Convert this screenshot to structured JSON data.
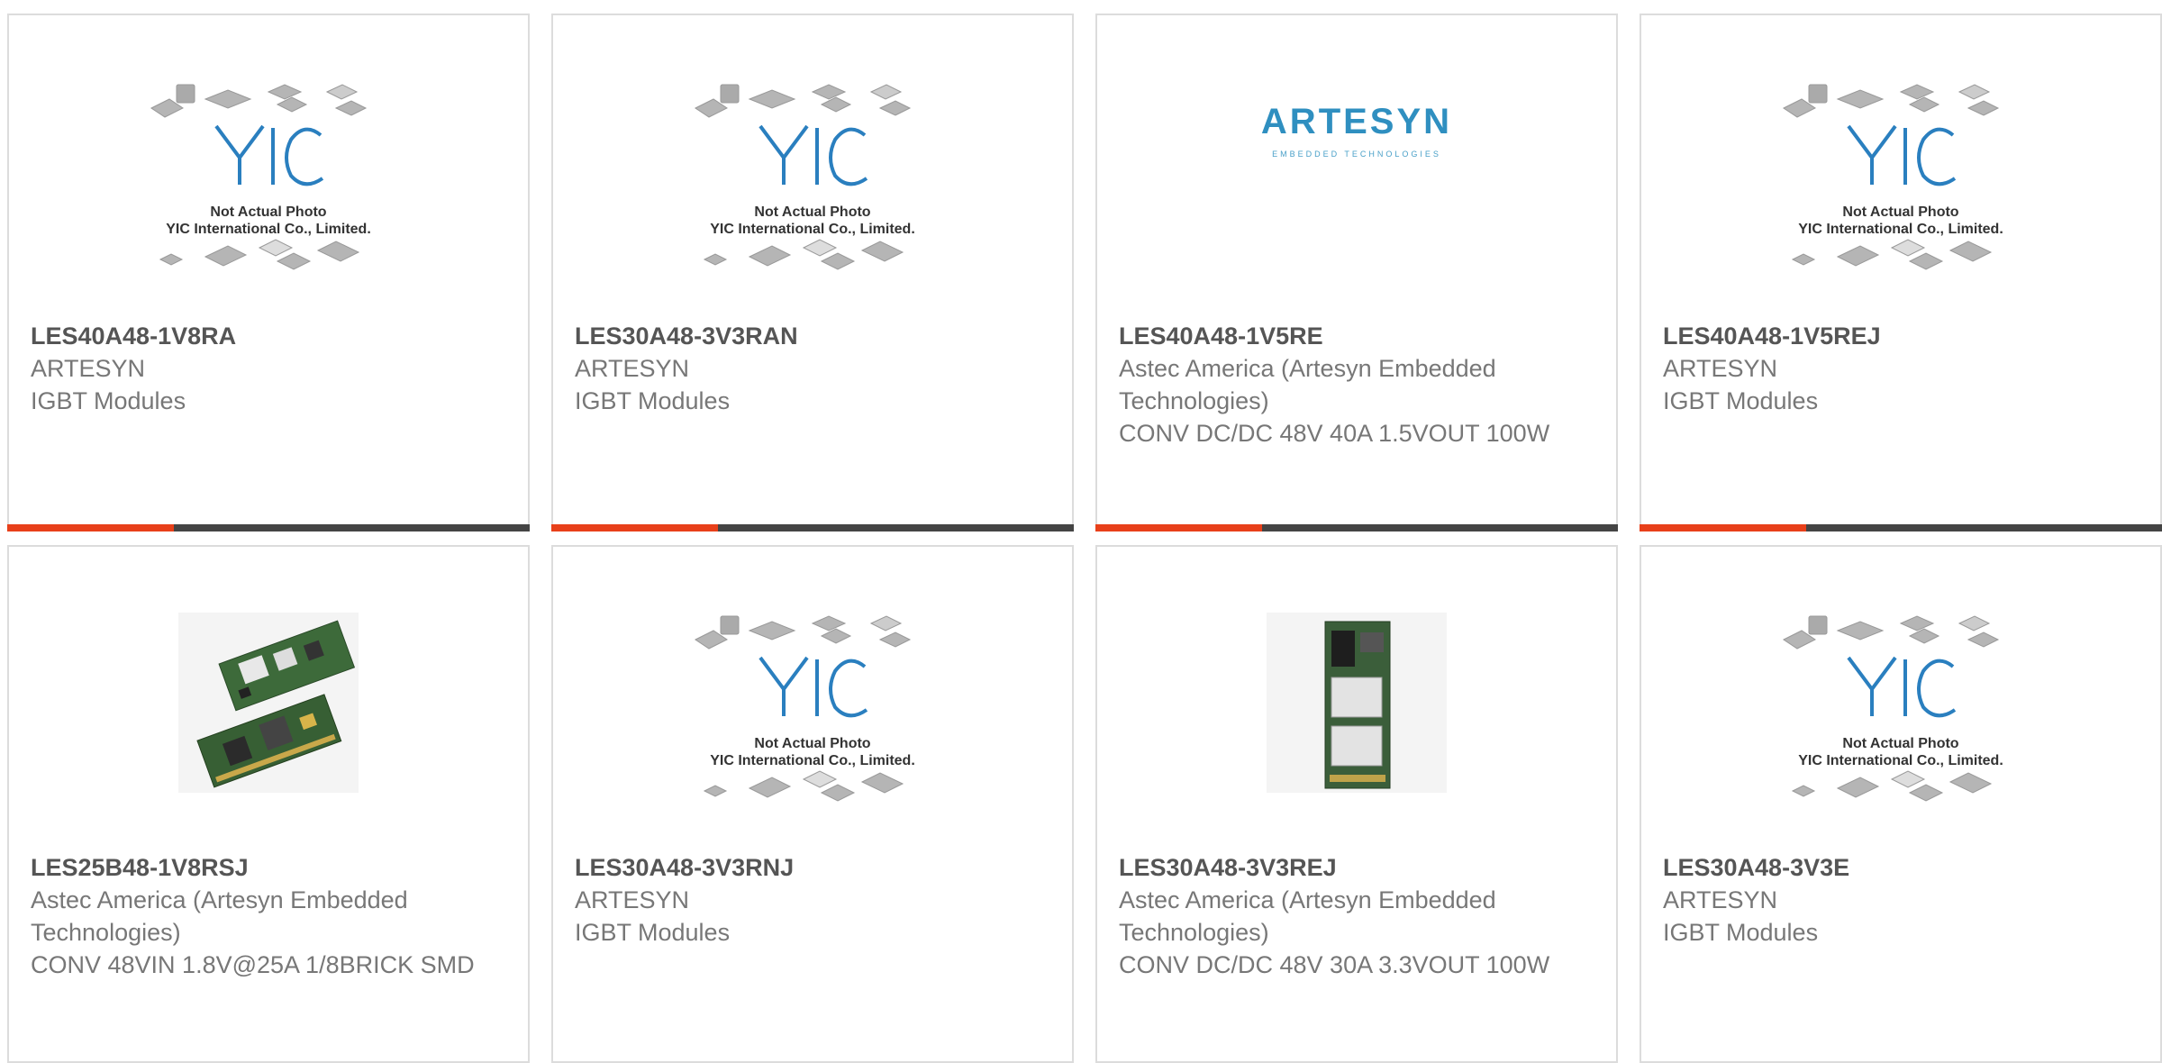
{
  "placeholder": {
    "logo_text": "YIC",
    "line1": "Not Actual Photo",
    "line2": "YIC International Co., Limited."
  },
  "brand_logo": {
    "name": "ARTESYN",
    "tagline": "EMBEDDED TECHNOLOGIES"
  },
  "colors": {
    "accent": "#e8401a",
    "bar": "#444444",
    "border": "#dcdcdc",
    "title": "#555555",
    "text": "#777777"
  },
  "products": [
    {
      "part": "LES40A48-1V8RA",
      "manufacturer": "ARTESYN",
      "description": "IGBT Modules",
      "image": "placeholder"
    },
    {
      "part": "LES30A48-3V3RAN",
      "manufacturer": "ARTESYN",
      "description": "IGBT Modules",
      "image": "placeholder"
    },
    {
      "part": "LES40A48-1V5RE",
      "manufacturer": "Astec America (Artesyn Embedded Technologies)",
      "description": "CONV DC/DC 48V 40A 1.5VOUT 100W",
      "image": "artesyn-logo"
    },
    {
      "part": "LES40A48-1V5REJ",
      "manufacturer": "ARTESYN",
      "description": "IGBT Modules",
      "image": "placeholder"
    },
    {
      "part": "LES25B48-1V8RSJ",
      "manufacturer": "Astec America (Artesyn Embedded Technologies)",
      "description": "CONV 48VIN 1.8V@25A 1/8BRICK SMD",
      "image": "board-pair-photo"
    },
    {
      "part": "LES30A48-3V3RNJ",
      "manufacturer": "ARTESYN",
      "description": "IGBT Modules",
      "image": "placeholder"
    },
    {
      "part": "LES30A48-3V3REJ",
      "manufacturer": "Astec America (Artesyn Embedded Technologies)",
      "description": "CONV DC/DC 48V 30A 3.3VOUT 100W",
      "image": "board-photo"
    },
    {
      "part": "LES30A48-3V3E",
      "manufacturer": "ARTESYN",
      "description": "IGBT Modules",
      "image": "placeholder"
    }
  ]
}
